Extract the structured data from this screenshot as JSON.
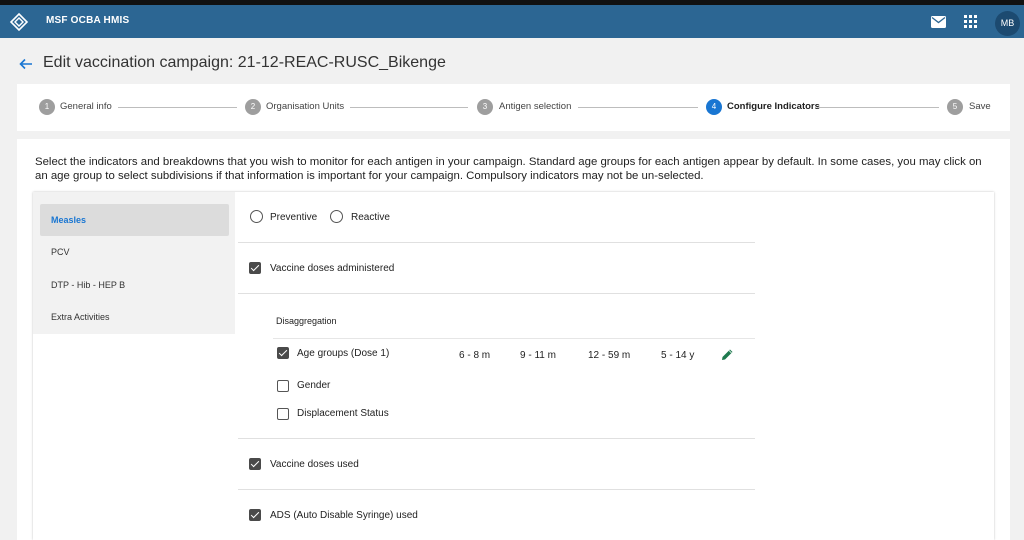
{
  "app": {
    "title": "MSF OCBA HMIS",
    "avatar_initials": "MB",
    "bar_color": "#2c6693"
  },
  "header_icons": {
    "mail": "mail-icon",
    "apps": "apps-grid-icon",
    "logo": "app-logo-icon"
  },
  "page": {
    "title": "Edit vaccination campaign: 21-12-REAC-RUSC_Bikenge",
    "back_icon": "arrow-left-icon"
  },
  "steps": [
    {
      "number": "1",
      "label": "General info"
    },
    {
      "number": "2",
      "label": "Organisation Units"
    },
    {
      "number": "3",
      "label": "Antigen selection"
    },
    {
      "number": "4",
      "label": "Configure Indicators",
      "active": true
    },
    {
      "number": "5",
      "label": "Save"
    }
  ],
  "instructions": "Select the indicators and breakdowns that you wish to monitor for each antigen in your campaign. Standard age groups for each antigen appear by default. In some cases, you may click on an age group to select subdivisions if that information is important for your campaign. Compulsory indicators may not be un-selected.",
  "antigens": [
    {
      "label": "Measles",
      "active": true
    },
    {
      "label": "PCV"
    },
    {
      "label": "DTP - Hib - HEP B"
    },
    {
      "label": "Extra Activities"
    }
  ],
  "campaign_type": {
    "options": [
      "Preventive",
      "Reactive"
    ]
  },
  "indicators": {
    "vaccine_doses_administered": {
      "label": "Vaccine doses administered",
      "checked": true
    },
    "disaggregation": {
      "title": "Disaggregation",
      "age_groups": {
        "label": "Age groups (Dose 1)",
        "checked": true,
        "groups": [
          "6 - 8 m",
          "9 - 11 m",
          "12 - 59 m",
          "5 - 14 y"
        ],
        "edit_icon": "pencil-icon"
      },
      "gender": {
        "label": "Gender",
        "checked": false
      },
      "displacement": {
        "label": "Displacement Status",
        "checked": false
      }
    },
    "vaccine_doses_used": {
      "label": "Vaccine doses used",
      "checked": true
    },
    "ads_used": {
      "label": "ADS (Auto Disable Syringe) used",
      "checked": true
    }
  },
  "colors": {
    "accent": "#1976d2",
    "edit_icon": "#1e7a4e"
  }
}
